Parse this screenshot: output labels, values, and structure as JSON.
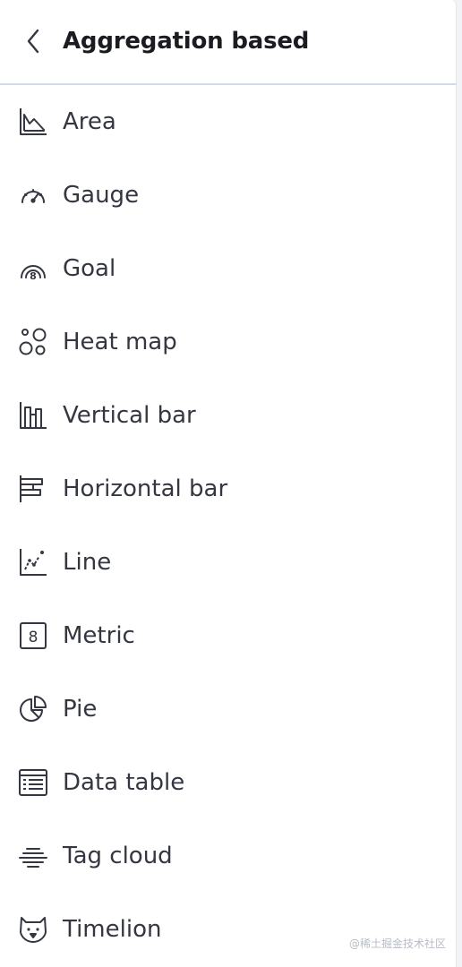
{
  "header": {
    "back_icon": "chevron-left-icon",
    "title": "Aggregation based"
  },
  "items": [
    {
      "label": "Area",
      "icon": "area-chart-icon"
    },
    {
      "label": "Gauge",
      "icon": "gauge-icon"
    },
    {
      "label": "Goal",
      "icon": "goal-icon"
    },
    {
      "label": "Heat map",
      "icon": "heat-map-icon"
    },
    {
      "label": "Vertical bar",
      "icon": "vertical-bar-icon"
    },
    {
      "label": "Horizontal bar",
      "icon": "horizontal-bar-icon"
    },
    {
      "label": "Line",
      "icon": "line-chart-icon"
    },
    {
      "label": "Metric",
      "icon": "metric-icon"
    },
    {
      "label": "Pie",
      "icon": "pie-chart-icon"
    },
    {
      "label": "Data table",
      "icon": "data-table-icon"
    },
    {
      "label": "Tag cloud",
      "icon": "tag-cloud-icon"
    },
    {
      "label": "Timelion",
      "icon": "timelion-icon"
    }
  ],
  "watermark": "@稀土掘金技术社区",
  "colors": {
    "text": "#343741",
    "title": "#1a1c21",
    "divider": "#d3dae6",
    "background": "#ffffff"
  }
}
